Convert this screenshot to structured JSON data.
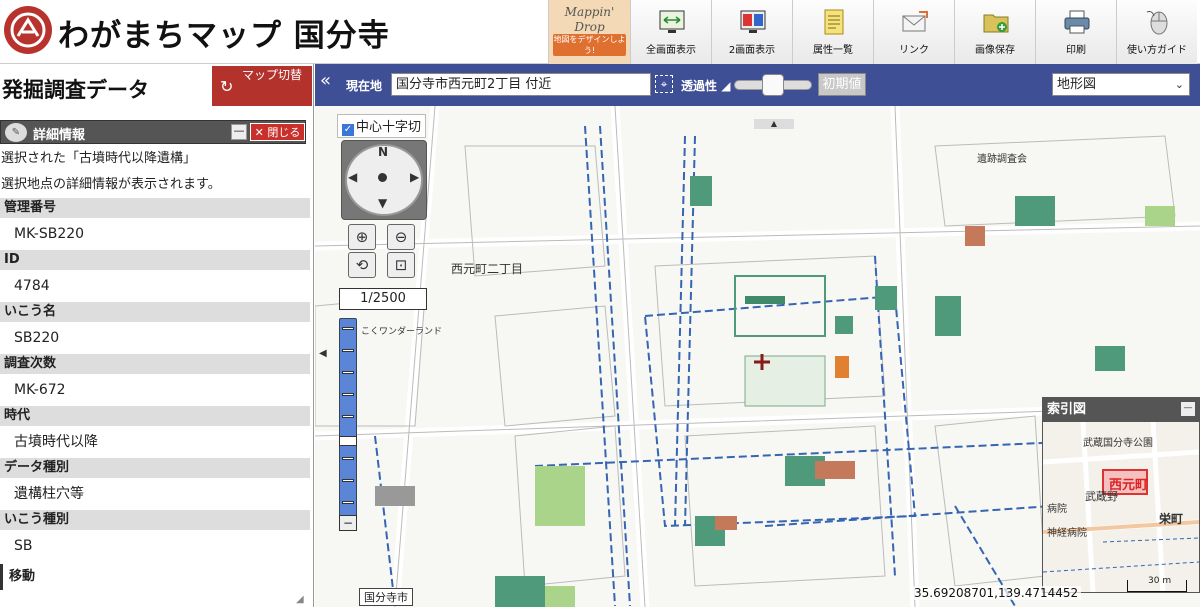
{
  "header": {
    "title": "わがまちマップ 国分寺",
    "mappin": {
      "line1": "Mappin'",
      "line2": "Drop",
      "tagline": "地図をデザインしよう!"
    },
    "tools": [
      {
        "label": "全画面表示",
        "icon": "fullscreen-icon"
      },
      {
        "label": "2画面表示",
        "icon": "split-view-icon"
      },
      {
        "label": "属性一覧",
        "icon": "attribute-list-icon"
      },
      {
        "label": "リンク",
        "icon": "link-mail-icon"
      },
      {
        "label": "画像保存",
        "icon": "save-image-icon"
      },
      {
        "label": "印刷",
        "icon": "print-icon"
      },
      {
        "label": "使い方ガイド",
        "icon": "guide-mouse-icon"
      }
    ]
  },
  "left_panel": {
    "title": "発掘調査データ",
    "switch_button": "マップ切替",
    "detail": {
      "title": "詳細情報",
      "close_label": "✕ 閉じる",
      "minimize_label": "—",
      "intro1": "選択された「古墳時代以降遺構」",
      "intro2": "選択地点の詳細情報が表示されます。",
      "fields": [
        {
          "label": "管理番号",
          "value": "MK-SB220"
        },
        {
          "label": "ID",
          "value": "4784"
        },
        {
          "label": "いこう名",
          "value": "SB220"
        },
        {
          "label": "調査次数",
          "value": "MK-672"
        },
        {
          "label": "時代",
          "value": "古墳時代以降"
        },
        {
          "label": "データ種別",
          "value": "遺構柱穴等"
        },
        {
          "label": "いこう種別",
          "value": "SB"
        }
      ],
      "move_label": "移動"
    }
  },
  "map": {
    "location_label": "現在地",
    "address": "国分寺市西元町2丁目 付近",
    "opacity_label": "透過性",
    "opacity_arrow": "◢",
    "opacity_value": 0.5,
    "init_button": "初期値",
    "basemap": "地形図",
    "center_cross_label": "中心十字切",
    "scale": "1/2500",
    "coordinates": "35.69208701,139.4714452",
    "city_tag": "国分寺市",
    "town_label": "西元町二丁目",
    "labels": {
      "survey_office": "遺跡調査会",
      "wonderland": "こくワンダーランド"
    },
    "index_map": {
      "title": "索引図",
      "town": "西元町",
      "park": "武蔵国分寺公園",
      "sakae": "栄町",
      "hospital": "病院",
      "neuro_hospital": "神経病院",
      "musashino": "武蔵野",
      "scale_label": "30 m"
    },
    "colors": {
      "toolbar_bar": "#3f4f96",
      "accent_red": "#b3322c",
      "dig_green": "#5fa37a",
      "boundary_blue": "#3565b3"
    }
  }
}
